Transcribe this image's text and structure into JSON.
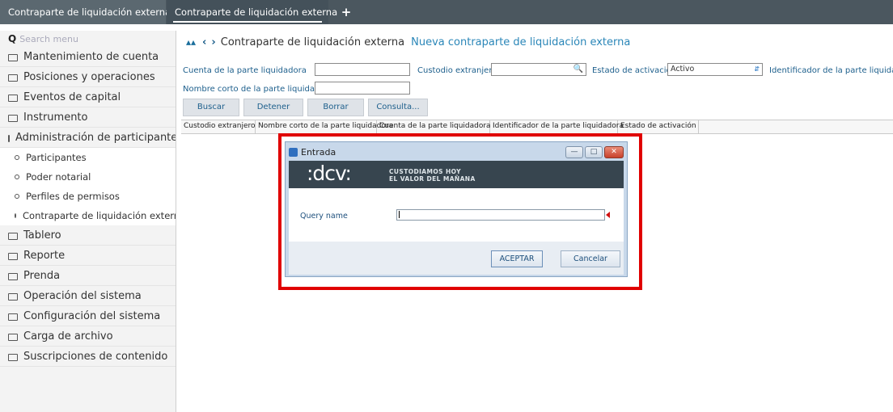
{
  "tabs": {
    "tab1": "Contraparte de liquidación externa",
    "tab2": "Contraparte de liquidación externa",
    "add": "+"
  },
  "sidebar": {
    "search_placeholder": "Search menu",
    "items": [
      "Mantenimiento de cuenta",
      "Posiciones y operaciones",
      "Eventos de capital",
      "Instrumento",
      "Administración de participantes"
    ],
    "subitems": [
      "Participantes",
      "Poder notarial",
      "Perfiles de permisos",
      "Contraparte de liquidación externa"
    ],
    "items_after": [
      "Tablero",
      "Reporte",
      "Prenda",
      "Operación del sistema",
      "Configuración del sistema",
      "Carga de archivo",
      "Suscripciones de contenido"
    ]
  },
  "breadcrumb": {
    "current": "Contraparte de liquidación externa",
    "new_link": "Nueva contraparte de liquidación externa"
  },
  "form": {
    "cuenta_label": "Cuenta de la parte liquidadora",
    "custodio_label": "Custodio extranjero",
    "estado_label": "Estado de activación",
    "estado_value": "Activo",
    "identificador_label": "Identificador de la parte liquidadora",
    "nombre_label": "Nombre corto de la parte liquidadora"
  },
  "buttons": {
    "buscar": "Buscar",
    "detener": "Detener",
    "borrar": "Borrar",
    "consulta": "Consulta..."
  },
  "grid_columns": [
    "Custodio extranjero",
    "Nombre corto de la parte liquidadora",
    "Cuenta de la parte liquidadora",
    "Identificador de la parte liquidadora",
    "Estado de activación"
  ],
  "dialog": {
    "title": "Entrada",
    "logo": ":dcv:",
    "slogan_line1": "CUSTODIAMOS HOY",
    "slogan_line2": "EL VALOR DEL MAÑANA",
    "query_label": "Query name",
    "query_value": "",
    "ok": "ACEPTAR",
    "cancel": "Cancelar"
  },
  "colors": {
    "topbar": "#4b575f",
    "accent": "#1d5f8c",
    "highlight": "#e00000"
  }
}
